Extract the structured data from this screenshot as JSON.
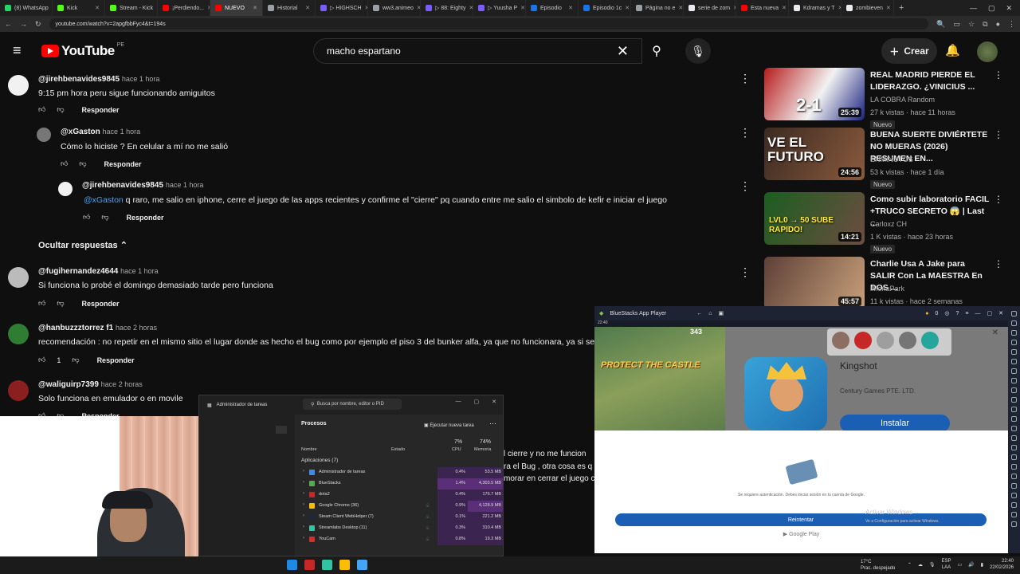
{
  "browser": {
    "tabs": [
      {
        "label": "(8) WhatsApp",
        "color": "#25d366"
      },
      {
        "label": "Kick",
        "color": "#53fc18"
      },
      {
        "label": "Stream - Kick",
        "color": "#53fc18"
      },
      {
        "label": "¡Perdiendo...",
        "color": "#ff0000"
      },
      {
        "label": "NUEVO",
        "color": "#ff0000"
      },
      {
        "label": "Historial",
        "color": "#9aa0a6"
      },
      {
        "label": "▷ HIGHSCH",
        "color": "#7b5cff"
      },
      {
        "label": "ww3.animeo",
        "color": "#9aa0a6"
      },
      {
        "label": "▷ 88: Eighty",
        "color": "#7b5cff"
      },
      {
        "label": "▷ Yuusha P",
        "color": "#7b5cff"
      },
      {
        "label": "Episodio",
        "color": "#1a73e8"
      },
      {
        "label": "Episodio 1c",
        "color": "#1a73e8"
      },
      {
        "label": "Página no e",
        "color": "#9aa0a6"
      },
      {
        "label": "serie de zom",
        "color": "#e8eaed"
      },
      {
        "label": "Esta nueva",
        "color": "#ff0000"
      },
      {
        "label": "Kdramas y T",
        "color": "#e8eaed"
      },
      {
        "label": "zombieven",
        "color": "#e8eaed"
      }
    ],
    "url": "youtube.com/watch?v=2apgfbbFyc4&t=194s"
  },
  "youtube": {
    "logo": "YouTube",
    "country": "PE",
    "search_value": "macho espartano",
    "create_label": "Crear"
  },
  "comments": [
    {
      "user": "@jirehbenavides9845",
      "time": "hace 1 hora",
      "text": "9:15 pm hora peru sigue funcionando amiguitos",
      "likes": "",
      "reply": "Responder"
    },
    {
      "user": "@xGaston",
      "time": "hace 1 hora",
      "text": "Cómo lo hiciste ? En celular a mí no me salió",
      "likes": "",
      "reply": "Responder"
    },
    {
      "user": "@jirehbenavides9845",
      "time": "hace 1 hora",
      "mention": "@xGaston",
      "text": " q raro, me salio en iphone, cerre el juego de las apps recientes y confirme el \"cierre\" pq cuando entre me salio el simbolo de kefir e iniciar el juego",
      "likes": "",
      "reply": "Responder"
    },
    {
      "user": "@fugihernandez4644",
      "time": "hace 1 hora",
      "text": "Si funciona lo probé el domingo demasiado tarde pero funciona",
      "likes": "",
      "reply": "Responder"
    },
    {
      "user": "@hanbuzzztorrez f1",
      "time": "hace 2 horas",
      "text": "recomendación : no repetir en el mismo sitio el lugar donde as hecho el bug como por ejemplo el piso 3 del bunker alfa, ya que no funcionara, ya si se",
      "likes": "1",
      "reply": "Responder"
    },
    {
      "user": "@waliguirp7399",
      "time": "hace 2 horas",
      "text": "Solo funciona en emulador o en movile",
      "likes": "",
      "reply": "Responder"
    }
  ],
  "hide_replies": "Ocultar respuestas",
  "fragments": [
    "l cierre y no me funcion",
    "ra el Bug , otra cosa es q",
    "morar en cerrar el juego c"
  ],
  "recommendations": [
    {
      "title": "REAL MADRID PIERDE EL LIDERAZGO. ¿VINICIUS ...",
      "channel": "LA COBRA Random",
      "meta": "27 k vistas · hace 11 horas",
      "badge": "Nuevo",
      "duration": "25:39",
      "thumb_text": "2-1"
    },
    {
      "title": "BUENA SUERTE DIVIÉRTETE NO MUERAS (2026) RESUMEN EN...",
      "channel": "ENMINUTOS",
      "meta": "53 k vistas · hace 1 día",
      "badge": "Nuevo",
      "duration": "24:56",
      "thumb_text": "VE EL FUTURO"
    },
    {
      "title": "Como subir laboratorio FACIL +TRUCO SECRETO 😱 | Last ...",
      "channel": "Carloxz CH",
      "meta": "1 K vistas · hace 23 horas",
      "badge": "Nuevo",
      "duration": "14:21",
      "thumb_text": "LVL0 → 50 SUBE RAPIDO!"
    },
    {
      "title": "Charlie Usa A Jake para SALIR Con La MAESTRA En DOS ...",
      "channel": "iMonaPark",
      "meta": "11 k vistas · hace 2 semanas",
      "badge": "",
      "duration": "45:57",
      "thumb_text": ""
    }
  ],
  "bluestacks": {
    "title": "BlueStacks App Player",
    "coins": "0",
    "game_label": "PROTECT THE CASTLE",
    "game_score": "343",
    "app_name": "Kingshot",
    "developer": "Century Games PTE. LTD.",
    "install": "Instalar",
    "auth_message": "Se requiere autenticación. Debes iniciar sesión en tu cuenta de Google.",
    "retry": "Reintentar",
    "store": "Google Play",
    "activate_title": "Activar Windows",
    "activate_sub": "Ve a Configuración para activar Windows.",
    "bar_time": "22:40"
  },
  "taskmanager": {
    "title": "Administrador de tareas",
    "search_placeholder": "Busca por nombre, editor o PID",
    "section": "Procesos",
    "run_task": "Ejecutar nueva tarea",
    "col_name": "Nombre",
    "col_state": "Estado",
    "cpu_pct": "7%",
    "cpu_label": "CPU",
    "mem_pct": "74%",
    "mem_label": "Memoria",
    "group": "Aplicaciones (7)",
    "rows": [
      {
        "name": "Administrador de tareas",
        "cpu": "0.4%",
        "mem": "53.5 MB",
        "color": "#3a8ee6"
      },
      {
        "name": "BlueStacks",
        "cpu": "1.4%",
        "mem": "4,303.5 MB",
        "color": "#4caf50"
      },
      {
        "name": "dota2",
        "cpu": "0.4%",
        "mem": "176.7 MB",
        "color": "#c62828"
      },
      {
        "name": "Google Chrome (36)",
        "cpu": "0.9%",
        "mem": "4,128.9 MB",
        "color": "#fbbc04"
      },
      {
        "name": "Steam Client WebHelper (7)",
        "cpu": "0.1%",
        "mem": "221.2 MB",
        "color": "#1b2838"
      },
      {
        "name": "Streamlabs Desktop (11)",
        "cpu": "0.3%",
        "mem": "310.4 MB",
        "color": "#31c3a2"
      },
      {
        "name": "YouCam",
        "cpu": "0.8%",
        "mem": "19.3 MB",
        "color": "#d32f2f"
      }
    ]
  },
  "taskbar": {
    "weather": "17°C",
    "weather_desc": "Prac. despejado",
    "lang": "ESP",
    "lang2": "LAA",
    "time": "22:40",
    "date": "22/02/2026"
  }
}
